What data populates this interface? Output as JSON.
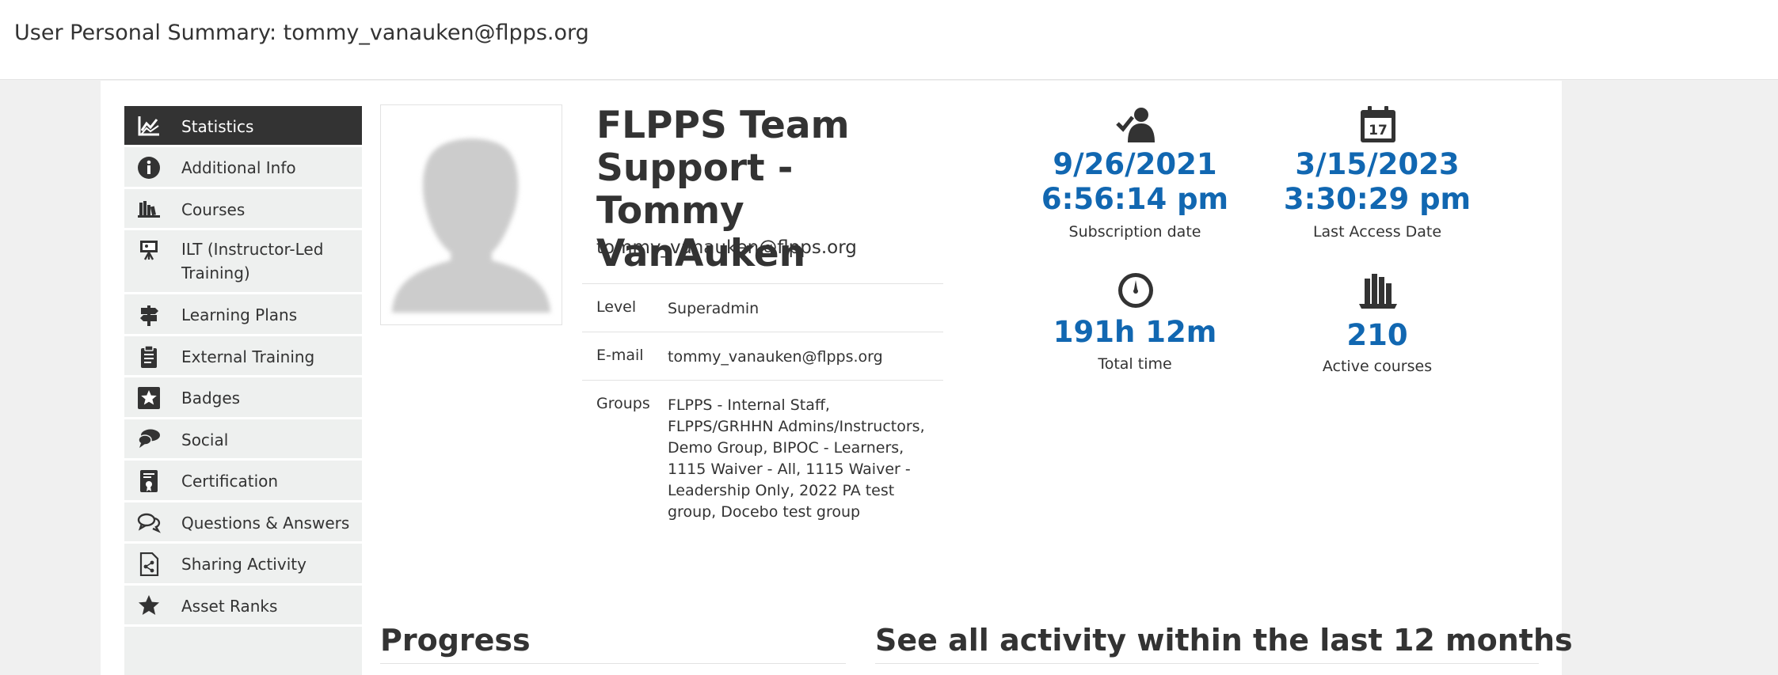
{
  "header": {
    "title": "User Personal Summary: tommy_vanauken@flpps.org"
  },
  "sidebar": {
    "items": [
      {
        "label": "Statistics",
        "icon": "statistics-chart-icon"
      },
      {
        "label": "Additional Info",
        "icon": "info-icon"
      },
      {
        "label": "Courses",
        "icon": "courses-icon"
      },
      {
        "label": "ILT (Instructor-Led Training)",
        "icon": "presentation-board-icon"
      },
      {
        "label": "Learning Plans",
        "icon": "signpost-icon"
      },
      {
        "label": "External Training",
        "icon": "clipboard-icon"
      },
      {
        "label": "Badges",
        "icon": "star-badge-icon"
      },
      {
        "label": "Social",
        "icon": "chat-bubbles-icon"
      },
      {
        "label": "Certification",
        "icon": "certificate-icon"
      },
      {
        "label": "Questions & Answers",
        "icon": "speech-bubbles-icon"
      },
      {
        "label": "Sharing Activity",
        "icon": "share-document-icon"
      },
      {
        "label": "Asset Ranks",
        "icon": "star-icon"
      }
    ]
  },
  "profile": {
    "name": "FLPPS Team Support - Tommy VanAuken",
    "email": "tommy_vanauken@flpps.org",
    "rows": [
      {
        "key": "Level",
        "value": "Superadmin"
      },
      {
        "key": "E-mail",
        "value": "tommy_vanauken@flpps.org"
      },
      {
        "key": "Groups",
        "value": "FLPPS - Internal Staff, FLPPS/GRHHN Admins/Instructors, Demo Group, BIPOC - Learners, 1115 Waiver - All, 1115 Waiver - Leadership Only, 2022 PA test group, Docebo test group"
      }
    ]
  },
  "stats": {
    "subscription": {
      "date": "9/26/2021",
      "time": "6:56:14 pm",
      "label": "Subscription date",
      "icon": "user-check-icon"
    },
    "last_access": {
      "date": "3/15/2023",
      "time": "3:30:29 pm",
      "label": "Last Access Date",
      "icon": "calendar-icon",
      "calendar_day": "17"
    },
    "total_time": {
      "value": "191h 12m",
      "label": "Total time",
      "icon": "stopwatch-icon"
    },
    "active_courses": {
      "value": "210",
      "label": "Active courses",
      "icon": "books-icon"
    }
  },
  "sections": {
    "progress": "Progress",
    "activity": "See all activity within the last 12 months"
  },
  "colors": {
    "accent": "#1167b1",
    "active_nav": "#333333",
    "sidebar_bg": "#eef0ef"
  }
}
